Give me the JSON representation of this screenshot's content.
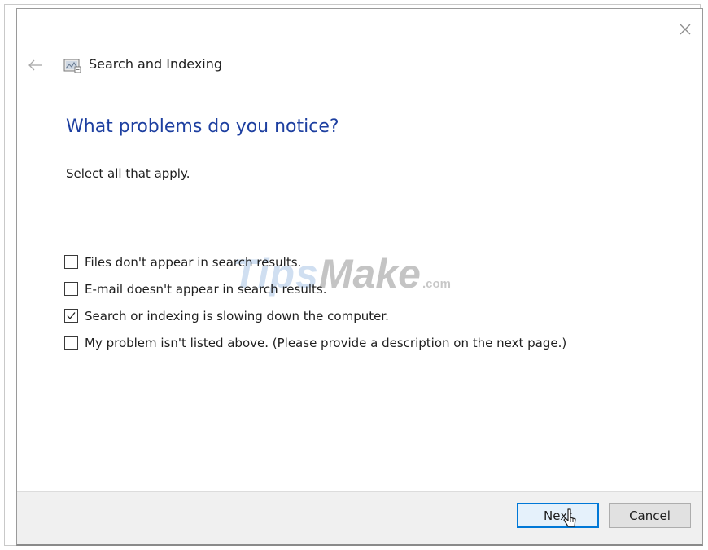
{
  "window": {
    "app_title": "Search and Indexing",
    "app_icon": "search-indexing-icon",
    "back_icon": "back-arrow-icon",
    "close_icon": "close-icon"
  },
  "main": {
    "heading": "What problems do you notice?",
    "instruction": "Select all that apply.",
    "options": [
      {
        "label": "Files don't appear in search results.",
        "checked": false
      },
      {
        "label": "E-mail doesn't appear in search results.",
        "checked": false
      },
      {
        "label": "Search or indexing is slowing down the computer.",
        "checked": true
      },
      {
        "label": "My problem isn't listed above. (Please provide a description on the next page.)",
        "checked": false
      }
    ]
  },
  "footer": {
    "next_label": "Next",
    "cancel_label": "Cancel"
  },
  "watermark": {
    "part1": "Tips",
    "part2": "Make",
    "part3": ".com"
  },
  "colors": {
    "heading": "#1d3fa0",
    "focus_border": "#0078d7",
    "footer_bg": "#f0f0f0"
  }
}
